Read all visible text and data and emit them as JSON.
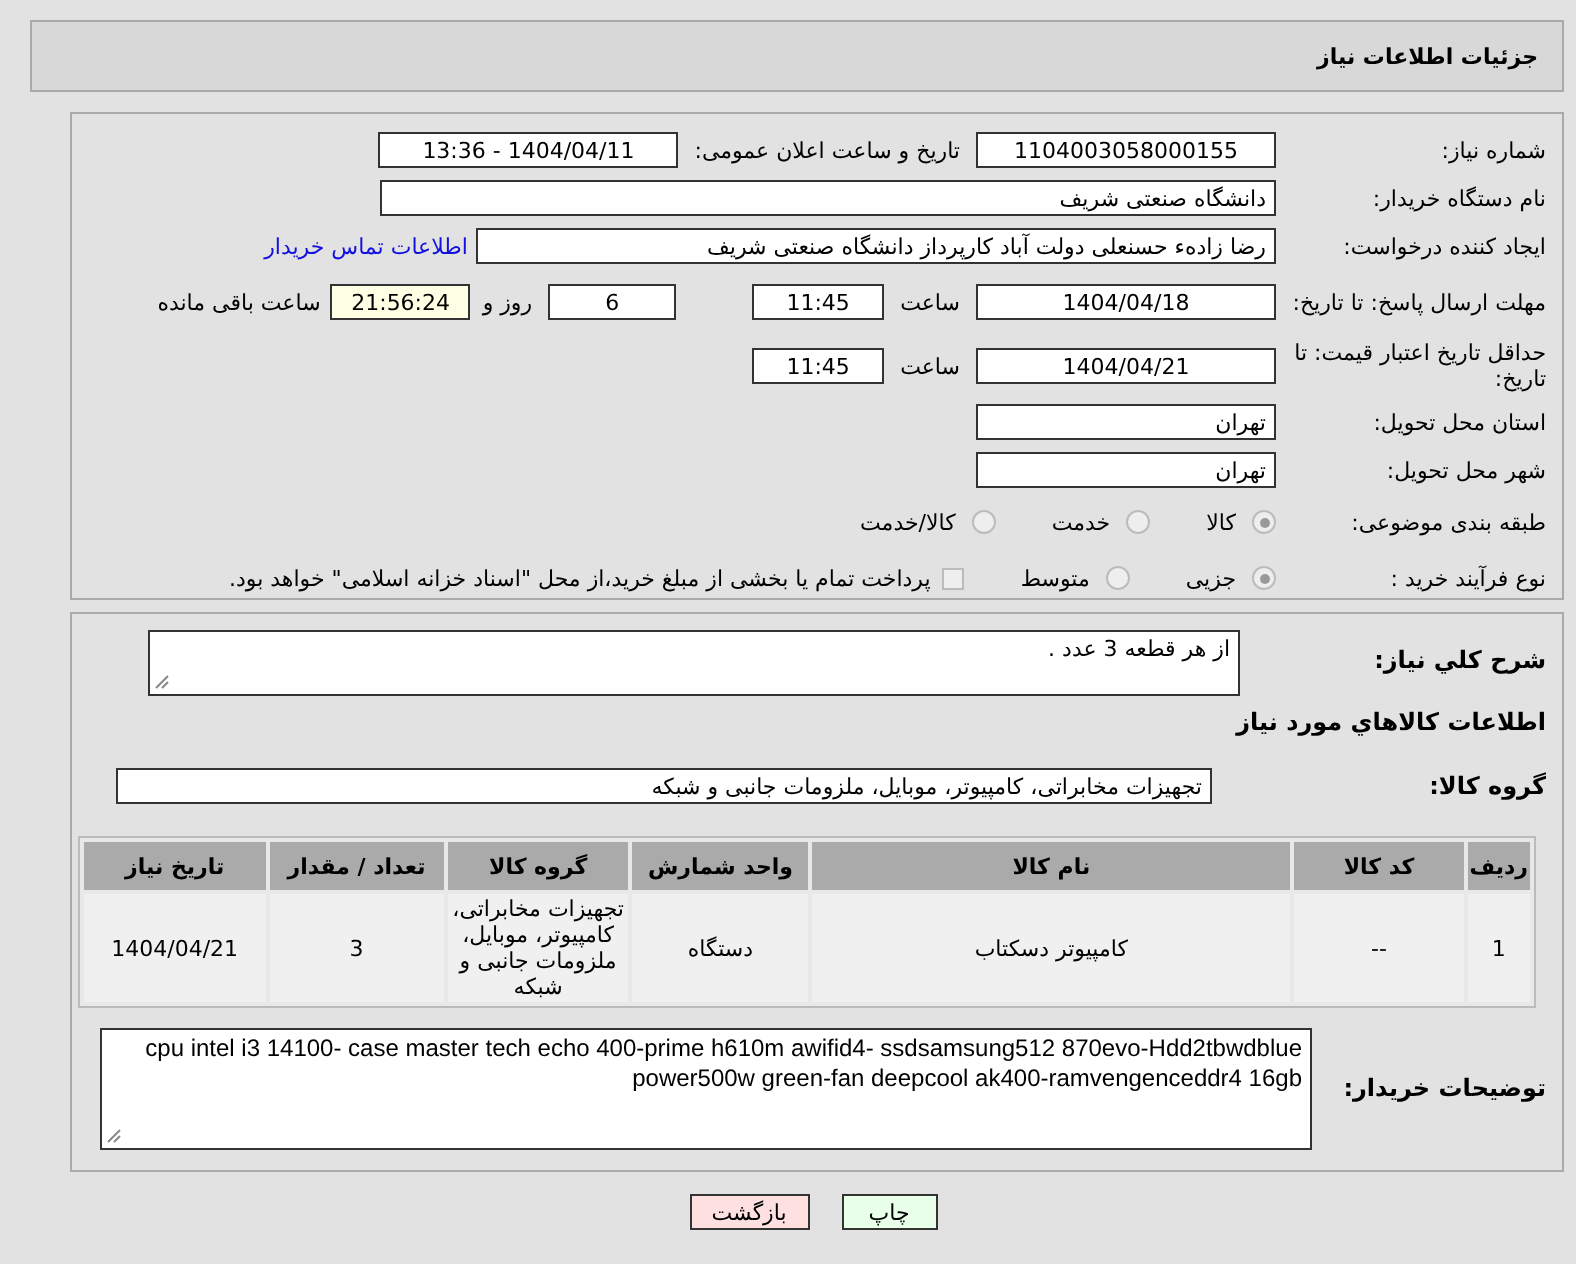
{
  "header": {
    "title": "جزئیات اطلاعات نیاز"
  },
  "need_number": {
    "label": "شماره نیاز:",
    "value": "1104003058000155"
  },
  "announce": {
    "label": "تاریخ و ساعت اعلان عمومی:",
    "value": "1404/04/11 - 13:36"
  },
  "buyer": {
    "label": "نام دستگاه خریدار:",
    "value": "دانشگاه صنعتی شریف"
  },
  "requester": {
    "label": "ایجاد کننده درخواست:",
    "value": "رضا زادهء حسنعلی دولت آباد کارپرداز دانشگاه صنعتی شریف",
    "link": "اطلاعات تماس خریدار"
  },
  "deadline": {
    "label": "مهلت ارسال پاسخ: تا تاریخ:",
    "date": "1404/04/18",
    "time_label": "ساعت",
    "time": "11:45",
    "days": "6",
    "days_label": "روز و",
    "remaining": "21:56:24",
    "remaining_label": "ساعت باقی مانده"
  },
  "validity": {
    "label": "حداقل تاریخ اعتبار قیمت: تا تاریخ:",
    "date": "1404/04/21",
    "time_label": "ساعت",
    "time": "11:45"
  },
  "province": {
    "label": "استان محل تحویل:",
    "value": "تهران"
  },
  "city": {
    "label": "شهر محل تحویل:",
    "value": "تهران"
  },
  "category": {
    "label": "طبقه بندی موضوعی:",
    "options": [
      {
        "label": "کالا",
        "selected": true
      },
      {
        "label": "خدمت",
        "selected": false
      },
      {
        "label": "کالا/خدمت",
        "selected": false
      }
    ]
  },
  "process": {
    "label": "نوع فرآیند خرید :",
    "options": [
      {
        "label": "جزیی",
        "selected": true
      },
      {
        "label": "متوسط",
        "selected": false
      }
    ],
    "payment": {
      "label": "پرداخت تمام یا بخشی از مبلغ خرید،از محل \"اسناد خزانه اسلامی\" خواهد بود.",
      "checked": false
    }
  },
  "description": {
    "label": "شرح کلي نياز:",
    "value": "از هر قطعه 3 عدد ."
  },
  "goods_title": "اطلاعات کالاهاي مورد نياز",
  "goods_group": {
    "label": "گروه کالا:",
    "value": "تجهیزات مخابراتی، کامپیوتر، موبایل، ملزومات جانبی و شبکه"
  },
  "table": {
    "columns": [
      "ردیف",
      "کد کالا",
      "نام کالا",
      "واحد شمارش",
      "گروه کالا",
      "تعداد / مقدار",
      "تاریخ نیاز"
    ],
    "rows": [
      {
        "cells": [
          "1",
          "--",
          "کامپیوتر دسکتاب",
          "دستگاه",
          "تجهیزات مخابراتی، کامپیوتر، موبایل، ملزومات جانبی و شبکه",
          "3",
          "1404/04/21"
        ]
      }
    ]
  },
  "buyer_notes": {
    "label": "توضیحات خریدار:",
    "value": "cpu intel i3 14100- case master tech echo 400-prime h610m awifid4- ssdsamsung512 870evo-Hdd2tbwdblue power500w green-fan deepcool ak400-ramvengenceddr4 16gb"
  },
  "buttons": [
    {
      "label": "چاپ",
      "kind": "print"
    },
    {
      "label": "بازگشت",
      "kind": "back"
    }
  ]
}
